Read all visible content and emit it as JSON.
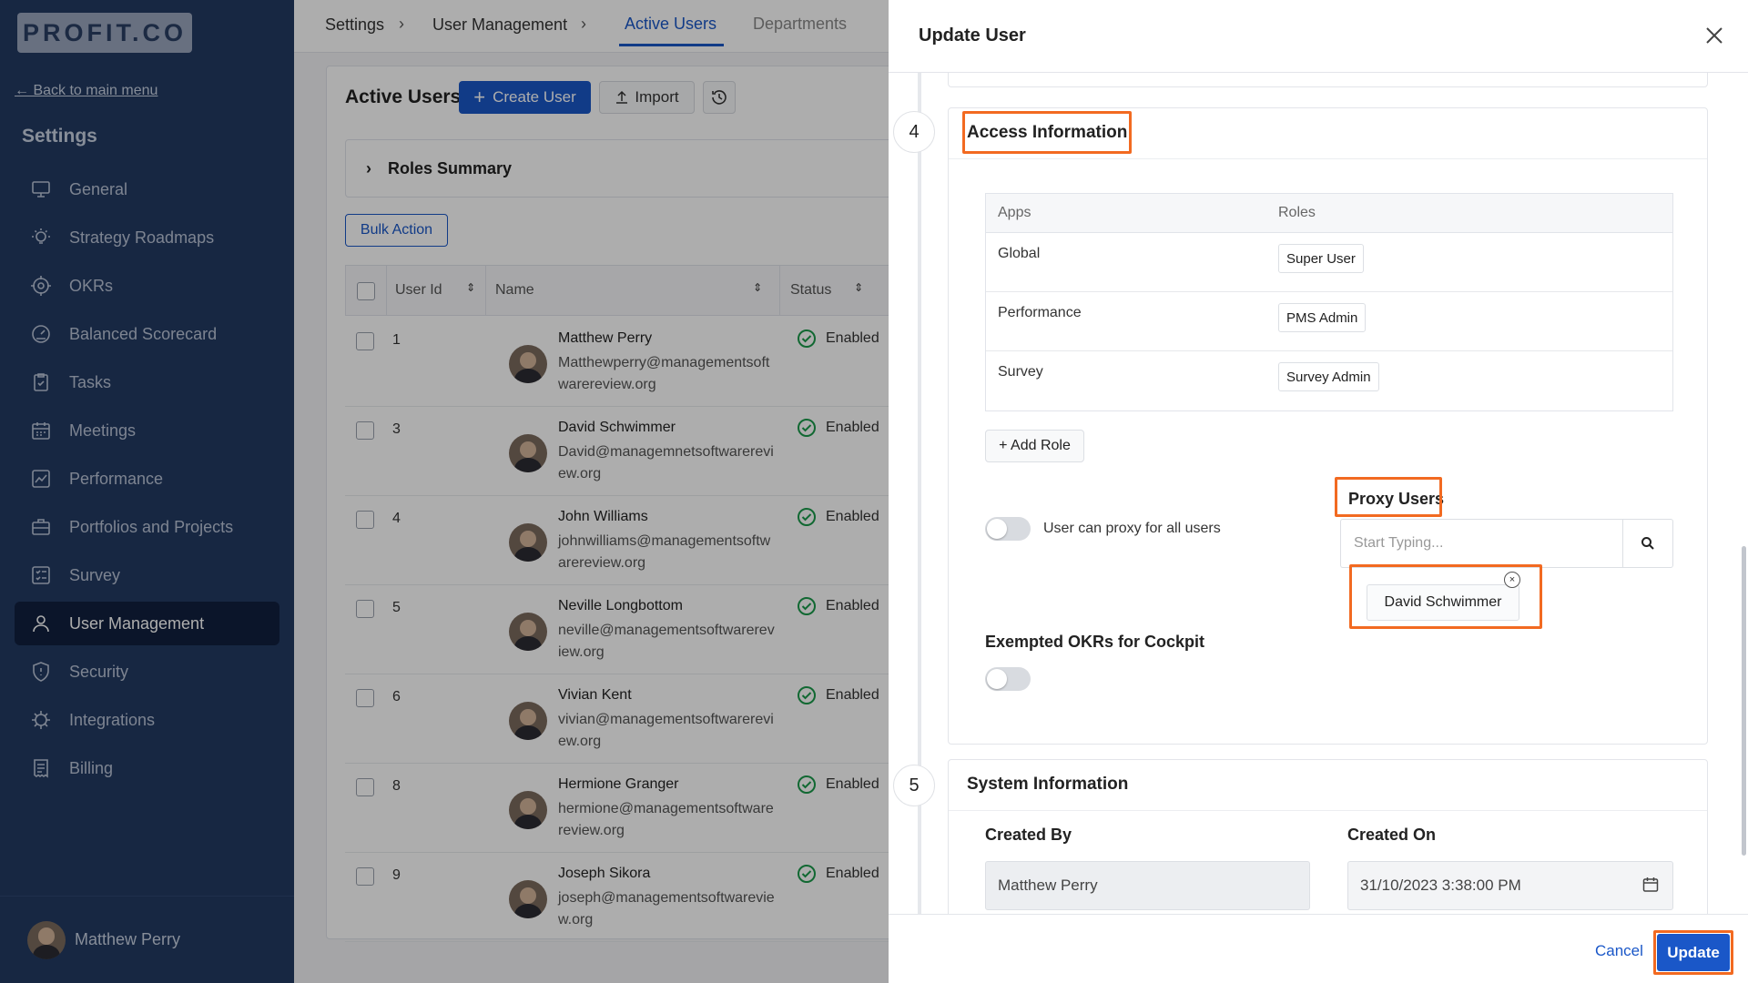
{
  "logo": {
    "text": "PROFIT.CO"
  },
  "sidebar": {
    "back_link": "← Back to main menu",
    "heading": "Settings",
    "items": [
      {
        "label": "General",
        "icon": "monitor-icon",
        "active": false
      },
      {
        "label": "Strategy Roadmaps",
        "icon": "bulb-icon",
        "active": false
      },
      {
        "label": "OKRs",
        "icon": "target-icon",
        "active": false
      },
      {
        "label": "Balanced Scorecard",
        "icon": "gauge-icon",
        "active": false
      },
      {
        "label": "Tasks",
        "icon": "clipboard-check-icon",
        "active": false
      },
      {
        "label": "Meetings",
        "icon": "calendar-icon",
        "active": false
      },
      {
        "label": "Performance",
        "icon": "chart-line-icon",
        "active": false
      },
      {
        "label": "Portfolios and Projects",
        "icon": "briefcase-icon",
        "active": false
      },
      {
        "label": "Survey",
        "icon": "checklist-icon",
        "active": false
      },
      {
        "label": "User Management",
        "icon": "user-icon",
        "active": true
      },
      {
        "label": "Security",
        "icon": "shield-icon",
        "active": false
      },
      {
        "label": "Integrations",
        "icon": "chip-icon",
        "active": false
      },
      {
        "label": "Billing",
        "icon": "receipt-icon",
        "active": false
      }
    ],
    "footer_user": "Matthew Perry"
  },
  "topbar": {
    "crumb_settings": "Settings",
    "crumb_user_mgmt": "User Management",
    "tab_active_users": "Active Users",
    "tab_departments": "Departments"
  },
  "main": {
    "title": "Active Users",
    "create_user": "Create User",
    "import": "Import",
    "roles_summary": "Roles Summary",
    "bulk_action": "Bulk Action",
    "columns": {
      "user_id": "User Id",
      "name": "Name",
      "status": "Status"
    },
    "rows": [
      {
        "id": "1",
        "name": "Matthew Perry",
        "email": "Matthewperry@managementsoftwarereview.org",
        "status": "Enabled"
      },
      {
        "id": "3",
        "name": "David Schwimmer",
        "email": "David@managemnetsoftwarereview.org",
        "status": "Enabled"
      },
      {
        "id": "4",
        "name": "John Williams",
        "email": "johnwilliams@managementsoftwarereview.org",
        "status": "Enabled"
      },
      {
        "id": "5",
        "name": "Neville Longbottom",
        "email": "neville@managementsoftwarereview.org",
        "status": "Enabled"
      },
      {
        "id": "6",
        "name": "Vivian Kent",
        "email": "vivian@managementsoftwarereview.org",
        "status": "Enabled"
      },
      {
        "id": "8",
        "name": "Hermione Granger",
        "email": "hermione@managementsoftwarereview.org",
        "status": "Enabled"
      },
      {
        "id": "9",
        "name": "Joseph Sikora",
        "email": "joseph@managementsoftwareview.org",
        "status": "Enabled"
      }
    ]
  },
  "panel": {
    "title": "Update User",
    "step4": "4",
    "access_title": "Access Information",
    "apps_header": "Apps",
    "roles_header": "Roles",
    "roles": [
      {
        "app": "Global",
        "role": "Super User"
      },
      {
        "app": "Performance",
        "role": "PMS Admin"
      },
      {
        "app": "Survey",
        "role": "Survey Admin"
      }
    ],
    "add_role": "+ Add Role",
    "proxy_all_label": "User can proxy for all users",
    "proxy_users_label": "Proxy Users",
    "proxy_placeholder": "Start Typing...",
    "proxy_chip": "David Schwimmer",
    "exempt_label": "Exempted OKRs for Cockpit",
    "step5": "5",
    "system_title": "System Information",
    "created_by_label": "Created By",
    "created_by_value": "Matthew Perry",
    "created_on_label": "Created On",
    "created_on_value": "31/10/2023 3:38:00 PM",
    "cancel": "Cancel",
    "update": "Update"
  },
  "colors": {
    "accent": "#1a57c8",
    "highlight": "#f26a21",
    "sidebar": "#233a62",
    "status_ok": "#1a9a4a"
  }
}
